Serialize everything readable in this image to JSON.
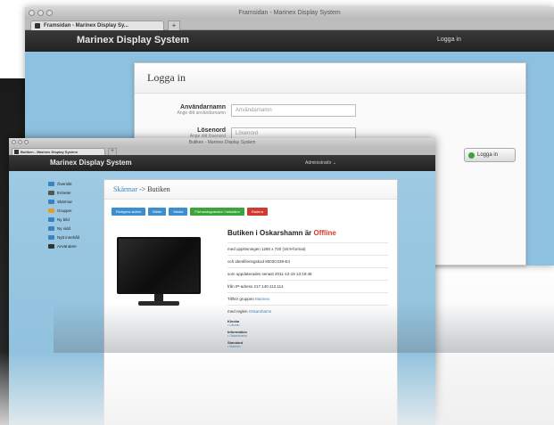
{
  "back_window": {
    "title": "Framsidan - Marinex Display System",
    "tab_label": "Framsidan - Marinex Display Sy...",
    "new_tab": "+",
    "brand": "Marinex Display System",
    "login_link": "Logga in",
    "login_card": {
      "heading": "Logga in",
      "username_label": "Användarnamn",
      "username_hint": "Ange ditt användarnamn",
      "username_placeholder": "Användarnamn",
      "password_label": "Lösenord",
      "password_hint": "Ange ditt lösenord",
      "password_placeholder": "Lösenord",
      "submit_label": "Logga in"
    }
  },
  "front_window": {
    "title": "Butiken - Marinex Display System",
    "tab_label": "Butiken - Marinex Display System",
    "new_tab": "+",
    "brand": "Marinex Display System",
    "admin_menu": "Administratör ⌄",
    "sidebar": [
      {
        "label": "Översikt",
        "icon": "home-icon",
        "color": "#3a82c4"
      },
      {
        "label": "Enheter",
        "icon": "monitor-icon",
        "color": "#555555"
      },
      {
        "label": "Skärmar",
        "icon": "screens-icon",
        "color": "#3a82c4"
      },
      {
        "label": "Grupper",
        "icon": "folder-icon",
        "color": "#e0a030"
      },
      {
        "label": "Ny bild",
        "icon": "image-icon",
        "color": "#3a82c4"
      },
      {
        "label": "Ny vidd",
        "icon": "video-icon",
        "color": "#3a82c4"
      },
      {
        "label": "Nytt innehåll",
        "icon": "content-icon",
        "color": "#3a82c4"
      },
      {
        "label": "Användare",
        "icon": "user-icon",
        "color": "#333333"
      }
    ],
    "breadcrumb": {
      "parent": "Skärmar",
      "separator": "->",
      "current": "Butiken"
    },
    "toolbar": [
      {
        "label": "Redigera skärm",
        "color": "blue"
      },
      {
        "label": "Bilder",
        "color": "blue"
      },
      {
        "label": "Media",
        "color": "blue"
      },
      {
        "label": "Förhandsgranska i helskärm",
        "color": "green"
      },
      {
        "label": "Radera",
        "color": "red"
      }
    ],
    "screen": {
      "heading_prefix": "Butiken i Oskarshamn är",
      "status": "Offline",
      "resolution": "med upplösningen 1280 x 720 (16:9-format)",
      "identifier": "och identifieringskod 8003C039-E4",
      "last_updated": "som uppdaterades senast 2011-12-19 13:19:48",
      "ip": "från IP-adress 217.140.112.114",
      "group_prefix": "Tillhör gruppen",
      "group_name": "Marinex",
      "rule_prefix": "med reglen",
      "rule_name": "Oskarshamn"
    },
    "meta": [
      {
        "label": "Klocka",
        "value": "• Ubuntu"
      },
      {
        "label": "Information",
        "value": "• Oskarshamn"
      },
      {
        "label": "Standard",
        "value": "• Marinex"
      }
    ]
  }
}
